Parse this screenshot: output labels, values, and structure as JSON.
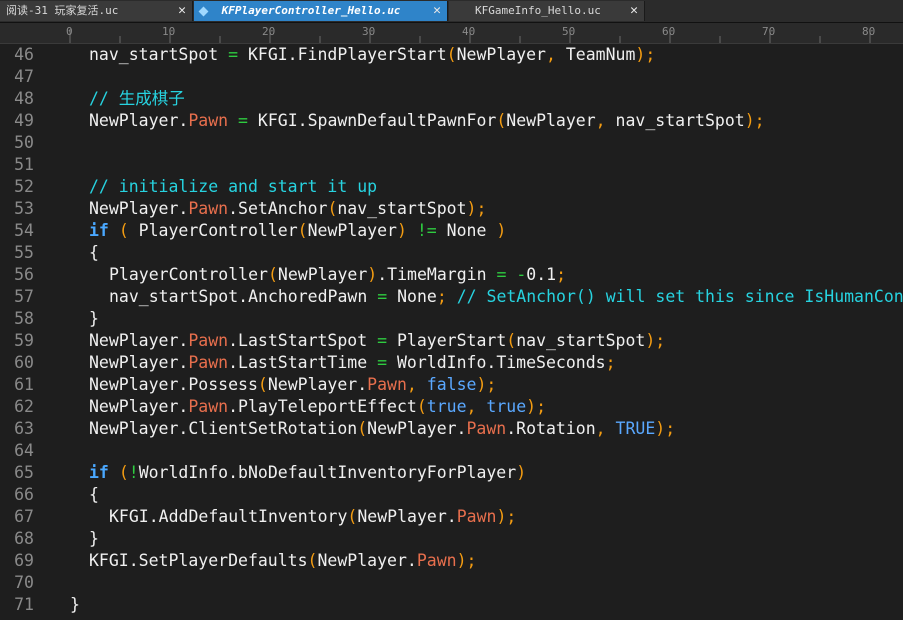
{
  "tabs": [
    {
      "label": "阅读-31 玩家复活.uc",
      "close": "✕"
    },
    {
      "label": "KFPlayerController_Hello.uc",
      "close": "✕"
    },
    {
      "label": "KFGameInfo_Hello.uc",
      "close": "✕"
    }
  ],
  "ruler": [
    "0",
    "10",
    "20",
    "30",
    "40",
    "50",
    "60",
    "70",
    "80"
  ],
  "lines": [
    {
      "n": "46",
      "t": "nav_startSpot = KFGI.FindPlayerStart(NewPlayer, TeamNum);"
    },
    {
      "n": "47",
      "t": ""
    },
    {
      "n": "48",
      "t": "// 生成棋子"
    },
    {
      "n": "49",
      "t": "NewPlayer.Pawn = KFGI.SpawnDefaultPawnFor(NewPlayer, nav_startSpot);"
    },
    {
      "n": "50",
      "t": ""
    },
    {
      "n": "51",
      "t": ""
    },
    {
      "n": "52",
      "t": "// initialize and start it up"
    },
    {
      "n": "53",
      "t": "NewPlayer.Pawn.SetAnchor(nav_startSpot);"
    },
    {
      "n": "54",
      "t": "if ( PlayerController(NewPlayer) != None )"
    },
    {
      "n": "55",
      "t": "{"
    },
    {
      "n": "56",
      "t": "PlayerController(NewPlayer).TimeMargin = -0.1;"
    },
    {
      "n": "57",
      "t": "nav_startSpot.AnchoredPawn = None; // SetAnchor() will set this since IsHumanCon"
    },
    {
      "n": "58",
      "t": "}"
    },
    {
      "n": "59",
      "t": "NewPlayer.Pawn.LastStartSpot = PlayerStart(nav_startSpot);"
    },
    {
      "n": "60",
      "t": "NewPlayer.Pawn.LastStartTime = WorldInfo.TimeSeconds;"
    },
    {
      "n": "61",
      "t": "NewPlayer.Possess(NewPlayer.Pawn, false);"
    },
    {
      "n": "62",
      "t": "NewPlayer.Pawn.PlayTeleportEffect(true, true);"
    },
    {
      "n": "63",
      "t": "NewPlayer.ClientSetRotation(NewPlayer.Pawn.Rotation, TRUE);"
    },
    {
      "n": "64",
      "t": ""
    },
    {
      "n": "65",
      "t": "if (!WorldInfo.bNoDefaultInventoryForPlayer)"
    },
    {
      "n": "66",
      "t": "{"
    },
    {
      "n": "67",
      "t": "KFGI.AddDefaultInventory(NewPlayer.Pawn);"
    },
    {
      "n": "68",
      "t": "}"
    },
    {
      "n": "69",
      "t": "KFGI.SetPlayerDefaults(NewPlayer.Pawn);"
    },
    {
      "n": "70",
      "t": ""
    },
    {
      "n": "71",
      "t": "}"
    }
  ]
}
